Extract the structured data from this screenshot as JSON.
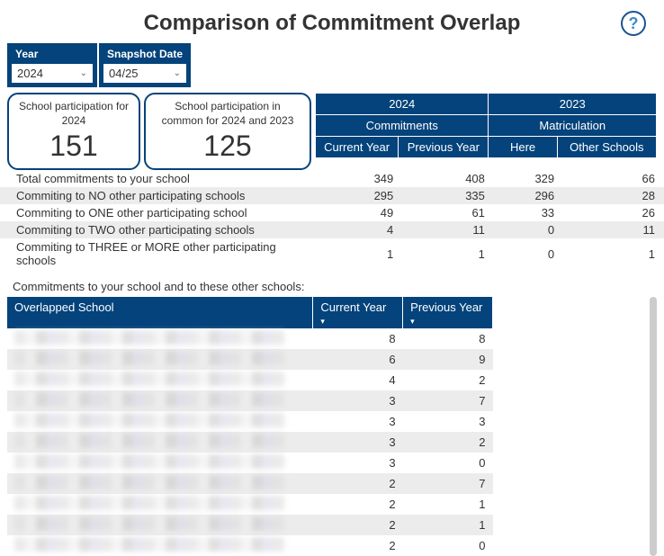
{
  "title": "Comparison of Commitment Overlap",
  "filters": {
    "year": {
      "label": "Year",
      "value": "2024"
    },
    "snapshot": {
      "label": "Snapshot Date",
      "value": "04/25"
    }
  },
  "stats": {
    "card1": {
      "label": "School participation for 2024",
      "value": "151"
    },
    "card2": {
      "label": "School participation in common for 2024 and 2023",
      "value": "125"
    }
  },
  "headerTable": {
    "year1": "2024",
    "year2": "2023",
    "group1": "Commitments",
    "group2": "Matriculation",
    "col1": "Current Year",
    "col2": "Previous Year",
    "col3": "Here",
    "col4": "Other Schools"
  },
  "summaryRows": [
    {
      "label": "Total commitments to your school",
      "v1": "349",
      "v2": "408",
      "v3": "329",
      "v4": "66"
    },
    {
      "label": "Commiting to NO other participating schools",
      "v1": "295",
      "v2": "335",
      "v3": "296",
      "v4": "28"
    },
    {
      "label": "Commiting to ONE other participating school",
      "v1": "49",
      "v2": "61",
      "v3": "33",
      "v4": "26"
    },
    {
      "label": "Commiting to TWO other participating schools",
      "v1": "4",
      "v2": "11",
      "v3": "0",
      "v4": "11"
    },
    {
      "label": "Commiting to THREE or MORE other participating schools",
      "v1": "1",
      "v2": "1",
      "v3": "0",
      "v4": "1"
    }
  ],
  "overlapSection": {
    "intro": "Commitments to your school and to these other schools:",
    "headers": {
      "school": "Overlapped School",
      "cy": "Current Year",
      "py": "Previous Year"
    },
    "rows": [
      {
        "cy": "8",
        "py": "8"
      },
      {
        "cy": "6",
        "py": "9"
      },
      {
        "cy": "4",
        "py": "2"
      },
      {
        "cy": "3",
        "py": "7"
      },
      {
        "cy": "3",
        "py": "3"
      },
      {
        "cy": "3",
        "py": "2"
      },
      {
        "cy": "3",
        "py": "0"
      },
      {
        "cy": "2",
        "py": "7"
      },
      {
        "cy": "2",
        "py": "1"
      },
      {
        "cy": "2",
        "py": "1"
      },
      {
        "cy": "2",
        "py": "0"
      }
    ]
  }
}
